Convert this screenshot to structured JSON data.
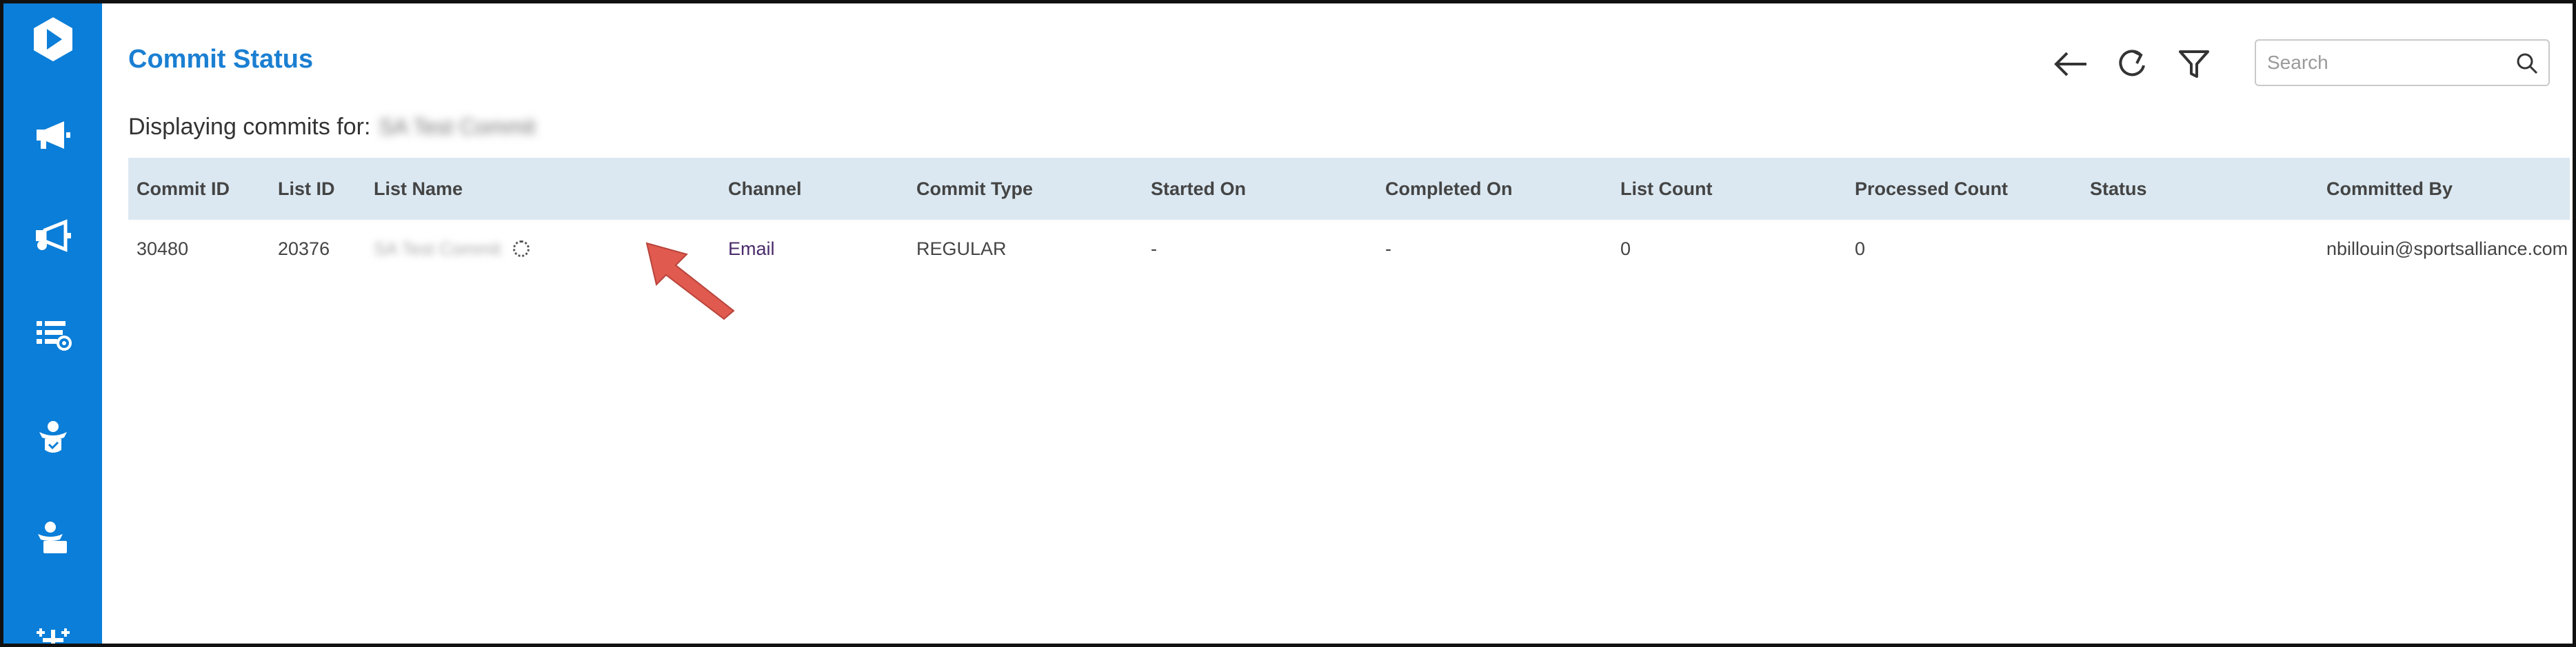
{
  "sidebar": {
    "items": [
      {
        "icon": "logo-icon"
      },
      {
        "icon": "megaphone-icon"
      },
      {
        "icon": "megaphone-settings-icon"
      },
      {
        "icon": "list-settings-icon"
      },
      {
        "icon": "person-check-icon"
      },
      {
        "icon": "person-list-icon"
      },
      {
        "icon": "sparkle-icon"
      }
    ],
    "background": "#0a7ed8"
  },
  "header": {
    "title": "Commit Status",
    "subtitle_label": "Displaying commits for:",
    "subtitle_value": "SA Test Commit"
  },
  "toolbar": {
    "back_icon": "arrow-left-icon",
    "refresh_icon": "refresh-icon",
    "filter_icon": "filter-icon"
  },
  "search": {
    "placeholder": "Search",
    "value": ""
  },
  "table": {
    "columns": [
      "Commit ID",
      "List ID",
      "List Name",
      "Channel",
      "Commit Type",
      "Started On",
      "Completed On",
      "List Count",
      "Processed Count",
      "Status",
      "Committed By"
    ],
    "rows": [
      {
        "commit_id": "30480",
        "list_id": "20376",
        "list_name": "SA Test Commit",
        "channel": "Email",
        "commit_type": "REGULAR",
        "started_on": "-",
        "completed_on": "-",
        "list_count": "0",
        "processed_count": "0",
        "status": "",
        "committed_by": "nbillouin@sportsalliance.com"
      }
    ]
  },
  "annotation": {
    "color": "#e05a4f"
  },
  "colors": {
    "accent": "#1a7fd2",
    "header_row": "#dbe8f1"
  }
}
